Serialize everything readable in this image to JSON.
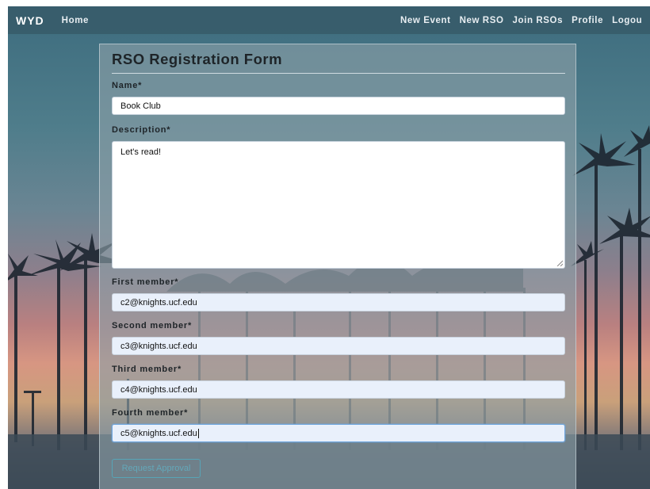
{
  "navbar": {
    "brand": "WYD",
    "home": "Home",
    "links": [
      "New Event",
      "New RSO",
      "Join RSOs",
      "Profile",
      "Logou"
    ]
  },
  "form": {
    "title": "RSO Registration Form",
    "name_label": "Name*",
    "name_value": "Book Club",
    "description_label": "Description*",
    "description_value": "Let's read!",
    "members": [
      {
        "label": "First member*",
        "value": "c2@knights.ucf.edu"
      },
      {
        "label": "Second member*",
        "value": "c3@knights.ucf.edu"
      },
      {
        "label": "Third member*",
        "value": "c4@knights.ucf.edu"
      },
      {
        "label": "Fourth member*",
        "value": "c5@knights.ucf.edu"
      }
    ],
    "submit_label": "Request Approval"
  },
  "colors": {
    "navbar": "#375a69",
    "accent": "#4fb0c6",
    "input_bg": "#e9f0fb"
  }
}
